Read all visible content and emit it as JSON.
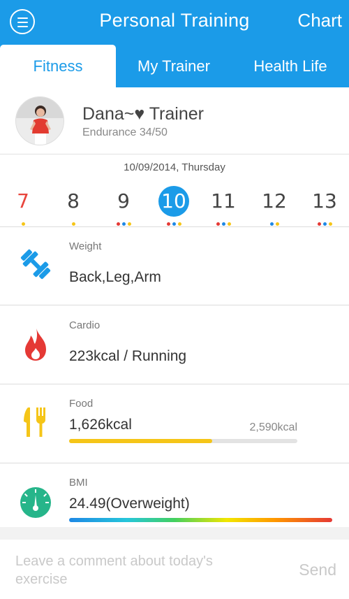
{
  "header": {
    "title": "Personal Training",
    "chart_label": "Chart",
    "menu_icon": "menu-icon"
  },
  "tabs": [
    {
      "label": "Fitness",
      "active": true
    },
    {
      "label": "My Trainer",
      "active": false
    },
    {
      "label": "Health Life",
      "active": false
    }
  ],
  "profile": {
    "name": "Dana~♥ Trainer",
    "endurance": "Endurance 34/50"
  },
  "calendar": {
    "date_label": "10/09/2014, Thursday",
    "days": [
      {
        "num": "7",
        "dots": [
          "#f5c518"
        ]
      },
      {
        "num": "8",
        "dots": [
          "#f5c518"
        ]
      },
      {
        "num": "9",
        "dots": [
          "#e53935",
          "#1e88e5",
          "#f5c518"
        ]
      },
      {
        "num": "10",
        "selected": true,
        "dots": [
          "#e53935",
          "#1e88e5",
          "#f5c518"
        ]
      },
      {
        "num": "11",
        "dots": [
          "#e53935",
          "#1e88e5",
          "#f5c518"
        ]
      },
      {
        "num": "12",
        "dots": [
          "#1e88e5",
          "#f5c518"
        ]
      },
      {
        "num": "13",
        "dots": [
          "#e53935",
          "#1e88e5",
          "#f5c518"
        ]
      }
    ]
  },
  "weight": {
    "label": "Weight",
    "value": "Back,Leg,Arm",
    "icon": "dumbbell-icon"
  },
  "cardio": {
    "label": "Cardio",
    "value": "223kcal / Running",
    "icon": "flame-icon"
  },
  "food": {
    "label": "Food",
    "value": "1,626kcal",
    "target": "2,590kcal",
    "progress": 0.628,
    "icon": "fork-knife-icon"
  },
  "bmi": {
    "label": "BMI",
    "value": "24.49(Overweight)",
    "icon": "gauge-icon"
  },
  "comment": {
    "placeholder": "Leave a comment about today's exercise",
    "send_label": "Send"
  },
  "colors": {
    "accent": "#1b9be8",
    "sunday": "#e8453c",
    "food_bar": "#f5c518",
    "cardio_icon": "#e53935",
    "bmi_icon": "#26b58a"
  }
}
